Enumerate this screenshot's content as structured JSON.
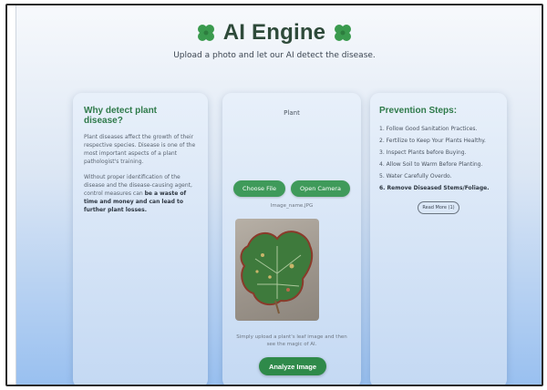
{
  "header": {
    "title": "AI Engine",
    "subtitle": "Upload a photo and let our AI detect the disease.",
    "left_icon": "clover-icon",
    "right_icon": "clover-icon",
    "accent_color": "#2e4a3a"
  },
  "why_card": {
    "heading": "Why detect plant disease?",
    "paragraph_1": "Plant diseases affect the growth of their respective species. Disease is one of the most important aspects of a plant pathologist's training.",
    "paragraph_2_start": "Without proper identification of the disease and the disease-causing agent, control measures can ",
    "paragraph_2_bold": "be a waste of time and money and can lead to further plant losses."
  },
  "upload_card": {
    "label": "Plant",
    "choose_button": "Choose File",
    "camera_button": "Open Camera",
    "file_caption": "Image_name.JPG",
    "hint": "Simply upload a plant's leaf image and then see the magic of AI.",
    "analyze_button": "Analyze Image",
    "button_color": "#3f9a5a"
  },
  "prevention_card": {
    "heading": "Prevention Steps:",
    "steps": [
      "1. Follow Good Sanitation Practices.",
      "2. Fertilize to Keep Your Plants Healthy.",
      "3. Inspect Plants before Buying.",
      "4. Allow Soil to Warm Before Planting.",
      "5. Water Carefully Overdo.",
      "6. Remove Diseased Stems/Foliage."
    ],
    "read_more": "Read More (1)"
  }
}
